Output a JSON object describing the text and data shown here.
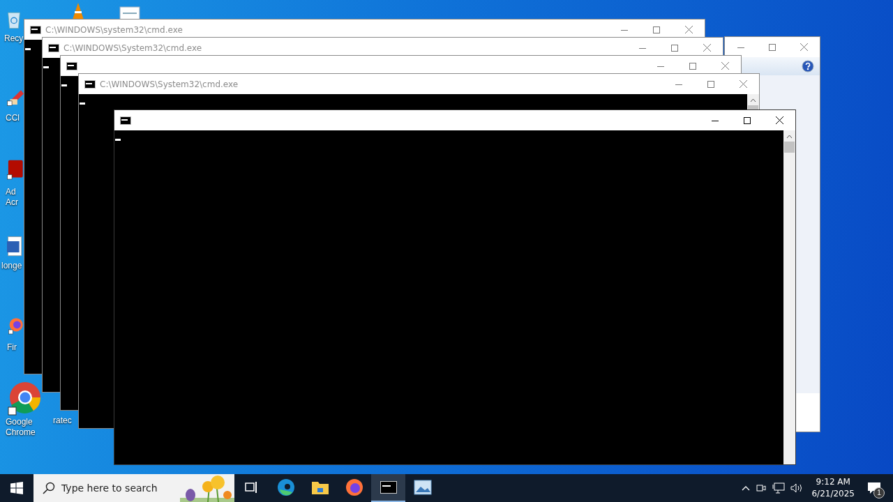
{
  "desktop_icons": [
    {
      "kind": "recycle",
      "lines": [
        "Recy"
      ]
    },
    {
      "kind": "cone"
    },
    {
      "kind": "document"
    },
    {
      "kind": "cleaner",
      "lines": [
        "CCl"
      ]
    },
    {
      "kind": "acrobat",
      "lines": [
        "Ad",
        "Acr"
      ]
    },
    {
      "kind": "word",
      "lines": [
        "longe"
      ]
    },
    {
      "kind": "firefox",
      "lines": [
        "Fir"
      ]
    },
    {
      "kind": "chrome",
      "lines": [
        "Google",
        "Chrome"
      ]
    },
    {
      "kind": "none",
      "lines": [
        "ratec"
      ]
    }
  ],
  "dialog": {
    "help": true
  },
  "windows": [
    {
      "title": "C:\\WINDOWS\\system32\\cmd.exe",
      "active": false
    },
    {
      "title": "C:\\WINDOWS\\System32\\cmd.exe",
      "active": false
    },
    {
      "active": false
    },
    {
      "title": "C:\\WINDOWS\\System32\\cmd.exe",
      "active": false,
      "scrollbar": true
    },
    {
      "active": true,
      "scrollbar": true
    }
  ],
  "taskbar": {
    "search": {
      "placeholder": "Type here to search"
    },
    "apps": [
      {
        "kind": "taskview",
        "selected": false
      },
      {
        "kind": "edge",
        "selected": false
      },
      {
        "kind": "explorer",
        "selected": false
      },
      {
        "kind": "firefox",
        "selected": false
      },
      {
        "kind": "cmd",
        "selected": true
      },
      {
        "kind": "photo",
        "selected": false
      }
    ],
    "time": "9:12 AM",
    "date": "6/21/2025",
    "notifications": "1"
  }
}
